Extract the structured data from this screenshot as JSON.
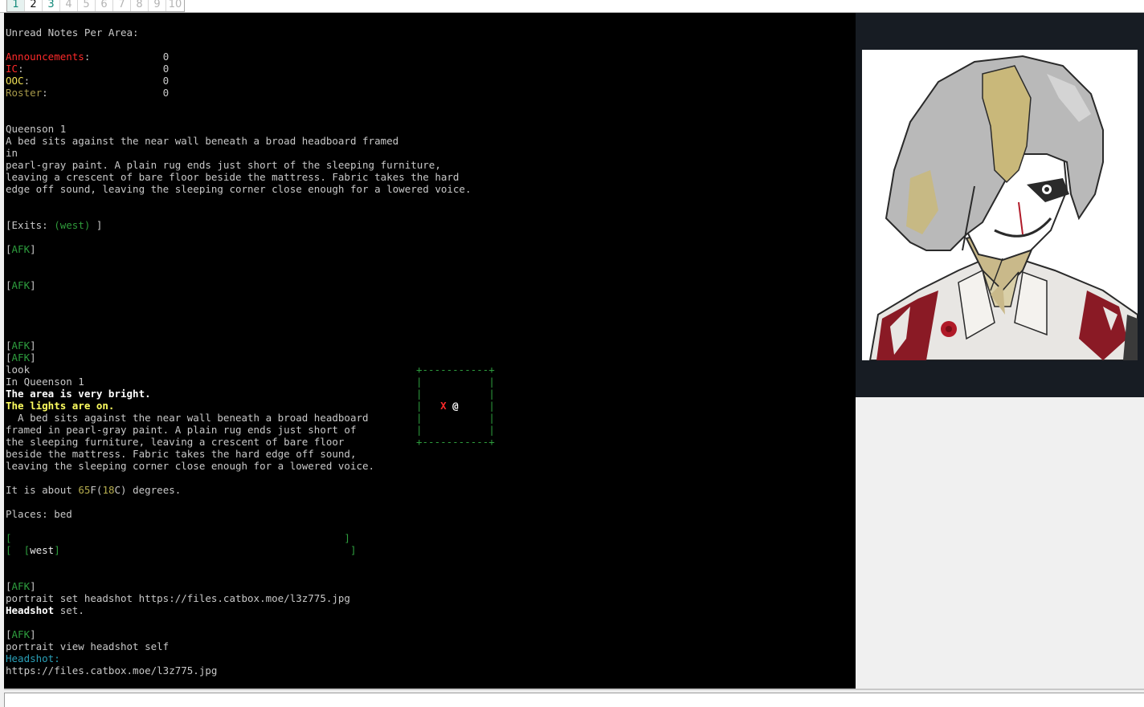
{
  "tabs": [
    {
      "label": "1",
      "state": "active"
    },
    {
      "label": "2",
      "state": "open"
    },
    {
      "label": "3",
      "state": "open"
    },
    {
      "label": "4",
      "state": "inactive"
    },
    {
      "label": "5",
      "state": "inactive"
    },
    {
      "label": "6",
      "state": "inactive"
    },
    {
      "label": "7",
      "state": "inactive"
    },
    {
      "label": "8",
      "state": "inactive"
    },
    {
      "label": "9",
      "state": "inactive"
    },
    {
      "label": "10",
      "state": "inactive"
    }
  ],
  "terminal": {
    "notes_header": "Unread Notes Per Area:",
    "notes": [
      {
        "label": "Announcements",
        "pad": ":            ",
        "count": "0"
      },
      {
        "label": "IC",
        "pad": ":                       ",
        "count": "0"
      },
      {
        "label": "OOC",
        "pad": ":                      ",
        "count": "0"
      },
      {
        "label": "Roster",
        "pad": ":                   ",
        "count": "0"
      }
    ],
    "room_title": "Queenson 1",
    "desc_lines": [
      "A bed sits against the near wall beneath a broad headboard framed",
      "in",
      "pearl-gray paint. A plain rug ends just short of the sleeping furniture,",
      "leaving a crescent of bare floor beside the mattress. Fabric takes the hard",
      "edge off sound, leaving the sleeping corner close enough for a lowered voice."
    ],
    "exits_prefix": "[Exits: ",
    "exits_value": "(west)",
    "exits_suffix": " ]",
    "afk": "AFK",
    "look_cmd": "look",
    "look_title": "In Queenson 1",
    "bright": "The area is very bright.",
    "lights": "The lights are on.",
    "look_desc": [
      "  A bed sits against the near wall beneath a broad headboard",
      "framed in pearl-gray paint. A plain rug ends just short of",
      "the sleeping furniture, leaving a crescent of bare floor",
      "beside the mattress. Fabric takes the hard edge off sound,",
      "leaving the sleeping corner close enough for a lowered voice."
    ],
    "temp_prefix": "It is about ",
    "temp_f": "65",
    "temp_mid": "F(",
    "temp_c": "18",
    "temp_suffix": "C) degrees.",
    "places": "Places: bed",
    "exit_word": "west",
    "cmd_portrait_set": "portrait set headshot https://files.catbox.moe/l3z775.jpg",
    "headshot_word": "Headshot",
    "set_word": " set.",
    "cmd_portrait_view": "portrait view headshot self",
    "headshot_label": "Headshot:",
    "headshot_url": "https://files.catbox.moe/l3z775.jpg"
  },
  "minimap": {
    "border_top": "+-----------+",
    "border_side": "|",
    "marker_x": "X",
    "marker_self": "@",
    "border_bottom": "+-----------+"
  },
  "colors": {
    "announcements": "#ff2a2a",
    "ic": "#ff2a2a",
    "ooc": "#f0e055",
    "roster": "#a89a4a",
    "afk": "#2e9e3e",
    "headshot_label": "#2aa0b8"
  },
  "portrait": {
    "icon": "headshot-portrait-image"
  },
  "input": {
    "value": ""
  }
}
